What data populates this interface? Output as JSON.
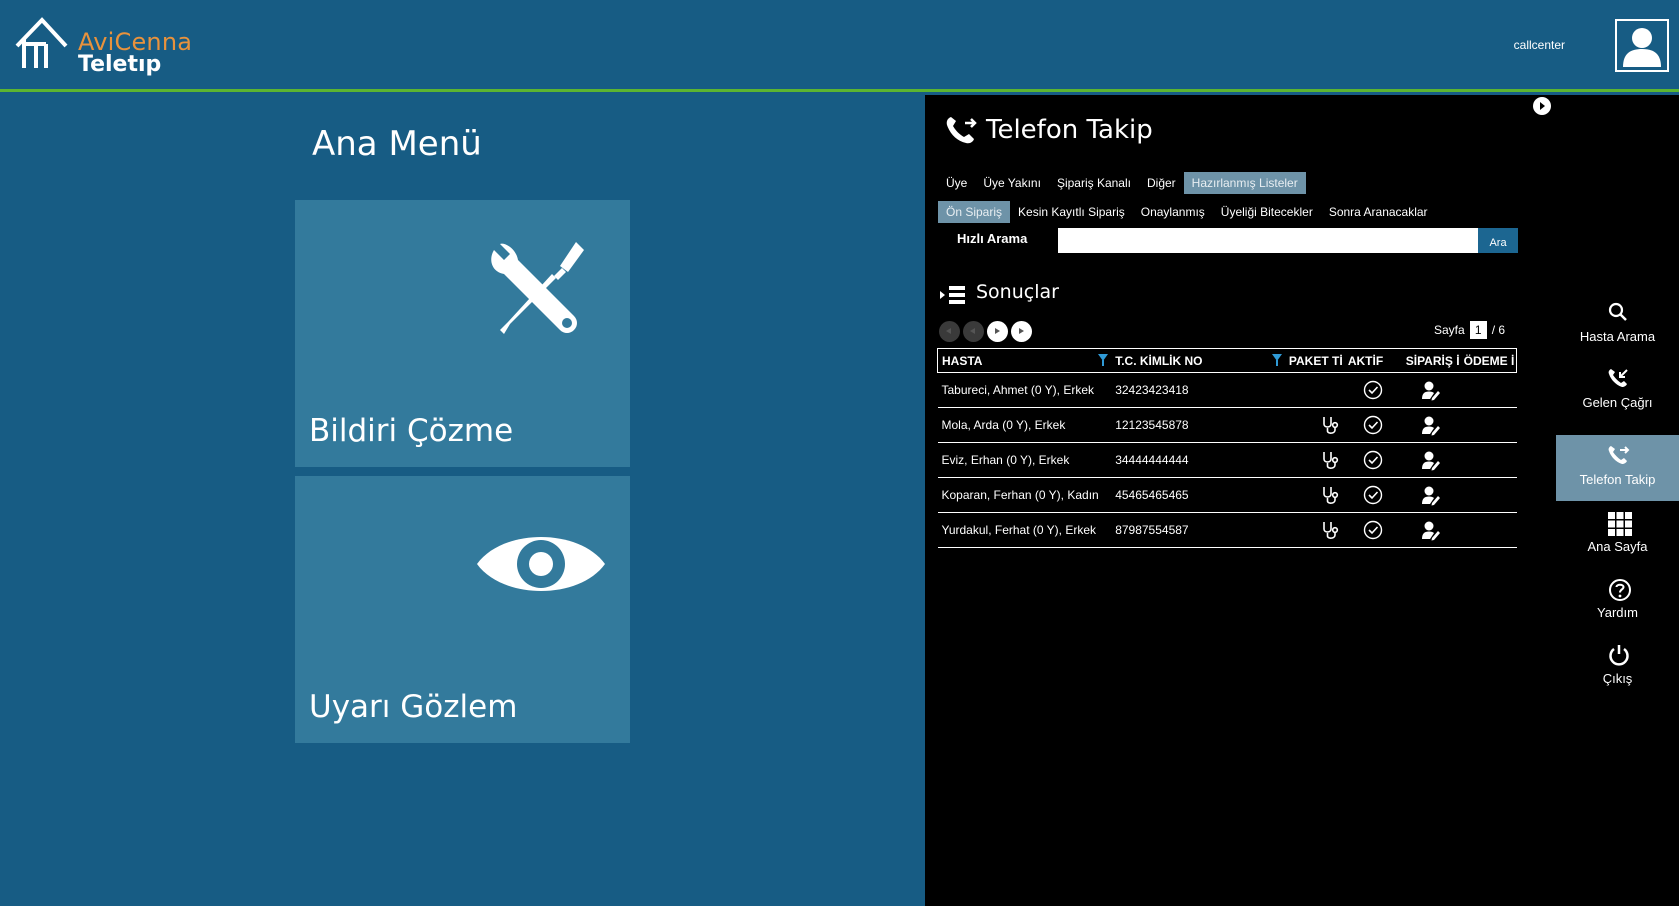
{
  "header": {
    "brand": "AviCenna",
    "brand_sub": "Teletıp",
    "user": "callcenter"
  },
  "main_menu": {
    "title": "Ana Menü",
    "tiles": [
      {
        "label": "Bildiri Çözme",
        "icon": "tools-icon"
      },
      {
        "label": "Uyarı Gözlem",
        "icon": "eye-icon"
      }
    ]
  },
  "panel": {
    "title": "Telefon Takip",
    "tabs_row1": [
      {
        "label": "Üye",
        "active": false
      },
      {
        "label": "Üye Yakını",
        "active": false
      },
      {
        "label": "Şipariş Kanalı",
        "active": false
      },
      {
        "label": "Diğer",
        "active": false
      },
      {
        "label": "Hazırlanmış Listeler",
        "active": true
      }
    ],
    "tabs_row2": [
      {
        "label": "Ön Sipariş",
        "active": true
      },
      {
        "label": "Kesin Kayıtlı Sipariş",
        "active": false
      },
      {
        "label": "Onaylanmış",
        "active": false
      },
      {
        "label": "Üyeliği Bitecekler",
        "active": false
      },
      {
        "label": "Sonra Aranacaklar",
        "active": false
      }
    ],
    "quick_search": {
      "label": "Hızlı Arama",
      "value": "",
      "button": "Ara"
    },
    "results": {
      "title": "Sonuçlar",
      "page_label": "Sayfa",
      "current_page": "1",
      "total_pages": "/ 6",
      "columns": [
        "HASTA",
        "T.C. KİMLİK NO",
        "PAKET Tİ",
        "AKTİF",
        "SİPARİŞ İ",
        "ÖDEME İ"
      ],
      "rows": [
        {
          "patient": "Tabureci, Ahmet (0 Y), Erkek",
          "tc": "32423423418",
          "package": false
        },
        {
          "patient": "Mola, Arda (0 Y), Erkek",
          "tc": "12123545878",
          "package": true
        },
        {
          "patient": "Eviz, Erhan (0 Y), Erkek",
          "tc": "34444444444",
          "package": true
        },
        {
          "patient": "Koparan, Ferhan (0 Y), Kadın",
          "tc": "45465465465",
          "package": true
        },
        {
          "patient": "Yurdakul, Ferhat (0 Y), Erkek",
          "tc": "87987554587",
          "package": true
        }
      ]
    }
  },
  "side_nav": [
    {
      "label": "Hasta Arama",
      "icon": "search-icon",
      "active": false
    },
    {
      "label": "Gelen Çağrı",
      "icon": "incoming-call-icon",
      "active": false
    },
    {
      "label": "Telefon Takip",
      "icon": "phone-track-icon",
      "active": true
    },
    {
      "label": "Ana Sayfa",
      "icon": "grid-icon",
      "active": false
    },
    {
      "label": "Yardım",
      "icon": "help-icon",
      "active": false
    },
    {
      "label": "Çıkış",
      "icon": "power-icon",
      "active": false
    }
  ],
  "colors": {
    "background": "#175c84",
    "tile": "#337a9c",
    "accent_green": "#5cb531",
    "brand_orange": "#e8923c",
    "active_tab": "#6e93a8",
    "panel": "#000000"
  }
}
